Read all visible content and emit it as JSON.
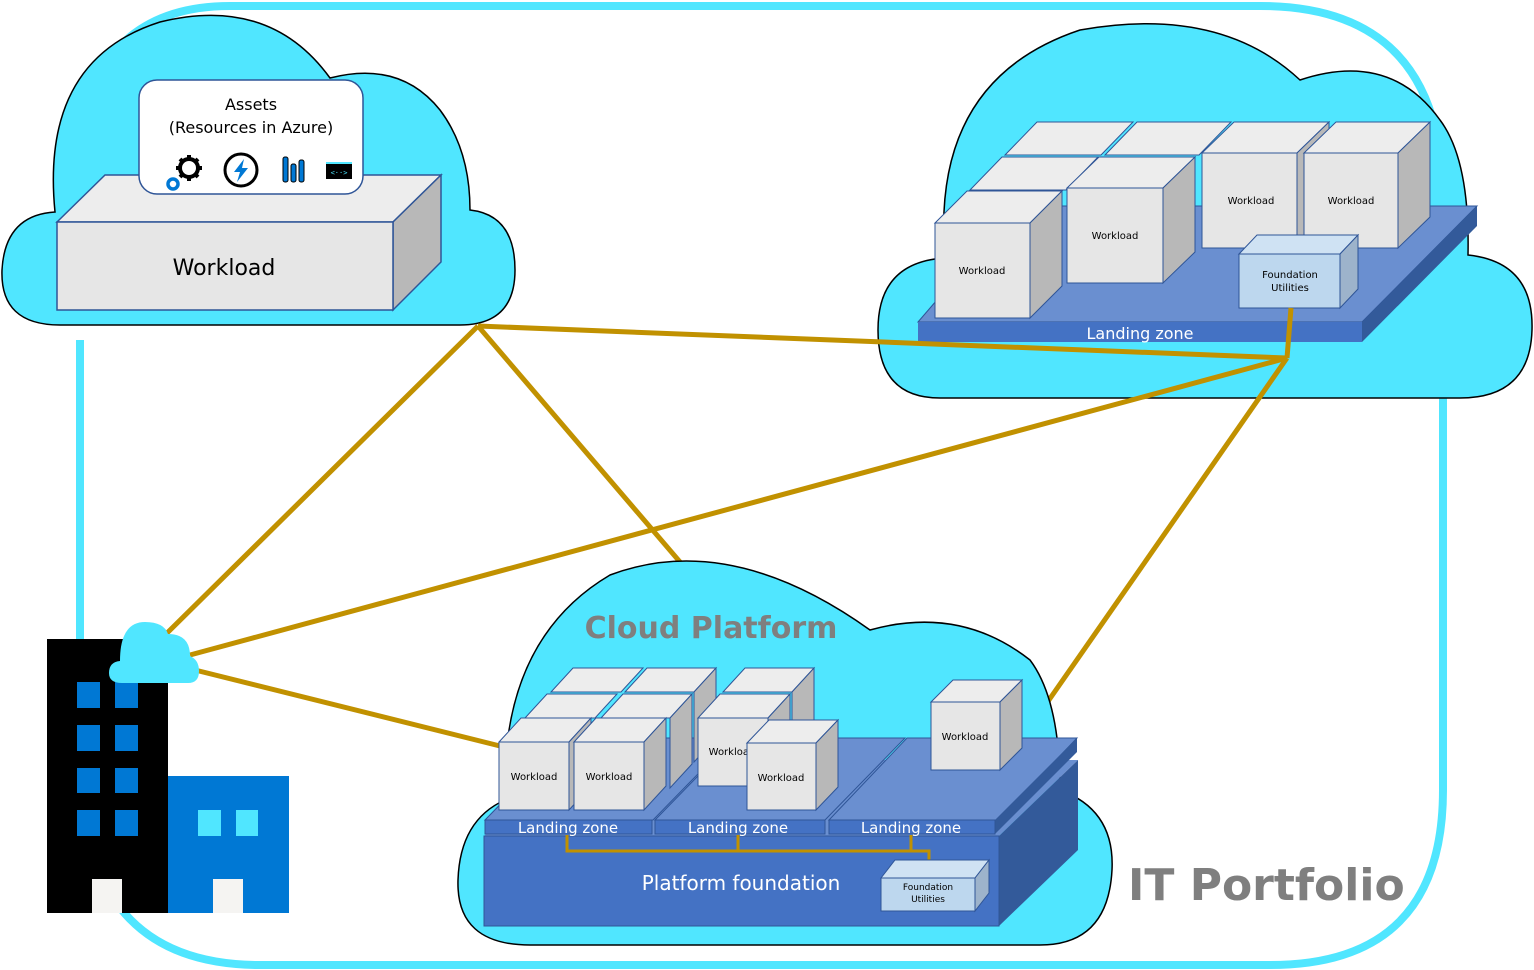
{
  "colors": {
    "portfolio_border": "#50E6FF",
    "cloud_fill": "#50E6FF",
    "connection": "#C19100",
    "box_front": "#E6E6E6",
    "box_top": "#EDEDED",
    "box_side": "#B8B8B8",
    "box_stroke": "#2F5597",
    "zone_top": "#6A8FD0",
    "zone_front": "#4472C4",
    "zone_side": "#335A9A",
    "utility_front": "#BDD7EE",
    "utility_side": "#9DB3CB",
    "heading_gray": "#7F7F7F",
    "building_dark": "#000000",
    "building_blue": "#0078D4",
    "window_light": "#50E6FF",
    "door": "#F5F4F2"
  },
  "portfolio": {
    "label": "IT Portfolio"
  },
  "workload_cloud": {
    "assets_card": {
      "title_line1": "Assets",
      "title_line2": "(Resources in Azure)",
      "icons": [
        "gears-icon",
        "lightning-icon",
        "test-tubes-icon",
        "code-window-icon"
      ]
    },
    "workload_label": "Workload"
  },
  "landing_zone_cloud": {
    "workloads": [
      "Workload",
      "Workload",
      "Workload",
      "Workload"
    ],
    "foundation_utilities": [
      "Foundation",
      "Utilities"
    ],
    "zone_label": "Landing zone"
  },
  "cloud_platform": {
    "title": "Cloud Platform",
    "landing_zones": [
      {
        "label": "Landing zone",
        "workloads": [
          "Workload",
          "Workload"
        ]
      },
      {
        "label": "Landing zone",
        "workloads": [
          "Workload",
          "Workload"
        ]
      },
      {
        "label": "Landing zone",
        "workloads": [
          "Workload"
        ]
      }
    ],
    "foundation_label": "Platform foundation",
    "foundation_utilities": [
      "Foundation",
      "Utilities"
    ]
  },
  "on_premises": {
    "icon": "office-building-cloud-icon"
  },
  "connections": [
    {
      "from": "workload-cloud",
      "to": "on-premises"
    },
    {
      "from": "workload-cloud",
      "to": "cloud-platform"
    },
    {
      "from": "workload-cloud",
      "to": "landing-zone-cloud"
    },
    {
      "from": "on-premises",
      "to": "landing-zone-cloud"
    },
    {
      "from": "on-premises",
      "to": "cloud-platform"
    },
    {
      "from": "landing-zone-cloud",
      "to": "cloud-platform"
    }
  ]
}
